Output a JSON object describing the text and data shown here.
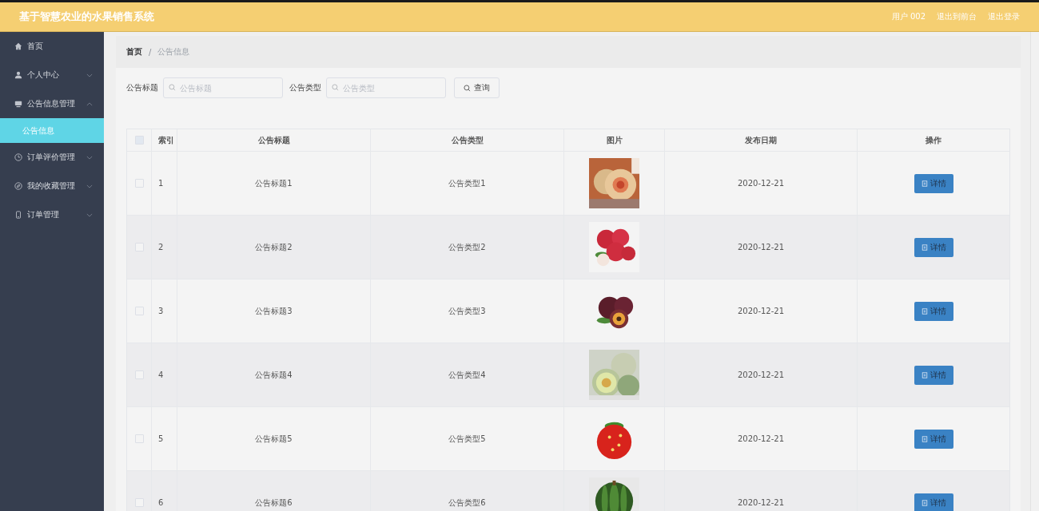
{
  "header": {
    "title": "基于智慧农业的水果销售系统",
    "links": [
      "用户 002",
      "退出到前台",
      "退出登录"
    ]
  },
  "sidebar": {
    "items": [
      {
        "label": "首页"
      },
      {
        "label": "个人中心",
        "expanded": false
      },
      {
        "label": "公告信息管理",
        "expanded": true,
        "children": [
          {
            "label": "公告信息",
            "selected": true
          }
        ]
      },
      {
        "label": "订单评价管理",
        "expanded": false
      },
      {
        "label": "我的收藏管理",
        "expanded": false
      },
      {
        "label": "订单管理",
        "expanded": false
      }
    ]
  },
  "breadcrumb": {
    "items": [
      "首页",
      "公告信息"
    ],
    "separator": "/"
  },
  "search": {
    "fields": [
      {
        "label": "公告标题",
        "placeholder": "公告标题"
      },
      {
        "label": "公告类型",
        "placeholder": "公告类型"
      }
    ],
    "button": "查询"
  },
  "table": {
    "columns": [
      "索引",
      "公告标题",
      "公告类型",
      "图片",
      "发布日期",
      "操作"
    ],
    "header_checked": false,
    "rows": [
      {
        "index": "1",
        "title": "公告标题1",
        "type": "公告类型1",
        "date": "2020-12-21",
        "action": "详情",
        "checked": false
      },
      {
        "index": "2",
        "title": "公告标题2",
        "type": "公告类型2",
        "date": "2020-12-21",
        "action": "详情",
        "checked": false
      },
      {
        "index": "3",
        "title": "公告标题3",
        "type": "公告类型3",
        "date": "2020-12-21",
        "action": "详情",
        "checked": false
      },
      {
        "index": "4",
        "title": "公告标题4",
        "type": "公告类型4",
        "date": "2020-12-21",
        "action": "详情",
        "checked": false
      },
      {
        "index": "5",
        "title": "公告标题5",
        "type": "公告类型5",
        "date": "2020-12-21",
        "action": "详情",
        "checked": false
      },
      {
        "index": "6",
        "title": "公告标题6",
        "type": "公告类型6",
        "date": "2020-12-21",
        "action": "详情",
        "checked": false
      }
    ]
  }
}
